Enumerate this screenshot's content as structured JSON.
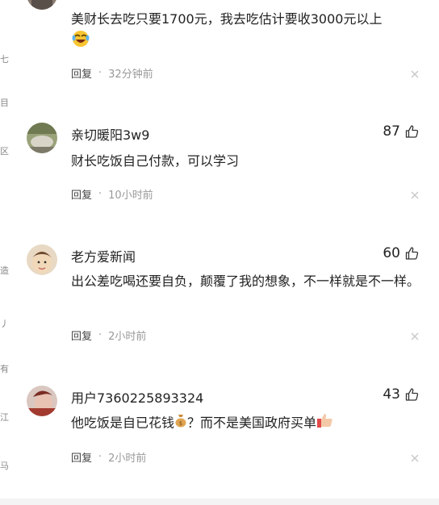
{
  "comments": [
    {
      "author": "",
      "text": "美财长去吃只要1700元，我去吃估计要收3000元以上",
      "reply_label": "回复",
      "time": "32分钟前",
      "likes": "",
      "avatar": "avatar-partial"
    },
    {
      "author": "亲切暖阳3w9",
      "text": "财长吃饭自己付款，可以学习",
      "reply_label": "回复",
      "time": "10小时前",
      "likes": "87",
      "avatar": "landscape-avatar"
    },
    {
      "author": "老方爱新闻",
      "text": "出公差吃喝还要自负，颠覆了我的想象，不一样就是不一样。",
      "reply_label": "回复",
      "time": "2小时前",
      "likes": "60",
      "avatar": "portrait-avatar"
    },
    {
      "author": "用户7360225893324",
      "text_before": "他吃饭是自已花钱",
      "text_middle": "？而不是美国政府买单",
      "reply_label": "回复",
      "time": "2小时前",
      "likes": "43",
      "avatar": "red-portrait-avatar"
    }
  ],
  "separator": "·",
  "icons": {
    "like": "thumbs-up-icon",
    "close": "close-icon",
    "laugh": "laughing-crying-emoji",
    "moneybag": "money-bag-emoji",
    "thumbsup": "thumbs-up-emoji"
  },
  "colors": {
    "text": "#222222",
    "meta": "#999999",
    "avatar_bg": "#c9b9a8"
  }
}
